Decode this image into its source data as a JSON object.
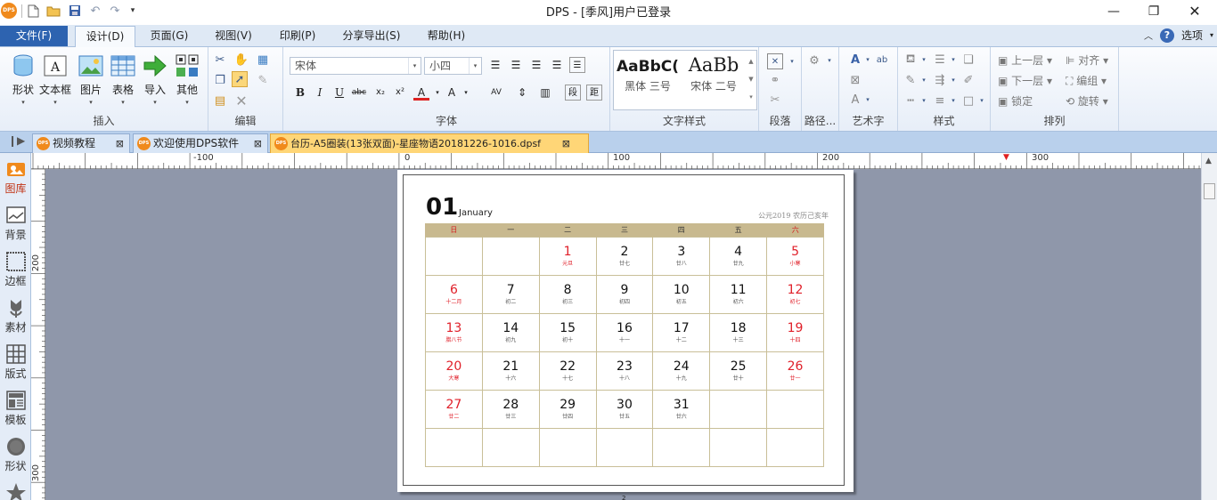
{
  "app": {
    "window_title": "DPS - [季风]用户已登录",
    "logo_text": "DPS"
  },
  "ribbon_tabs": {
    "file": "文件(F)",
    "tabs": [
      "设计(D)",
      "页面(G)",
      "视图(V)",
      "印刷(P)",
      "分享导出(S)",
      "帮助(H)"
    ],
    "active": "设计(D)",
    "options_label": "选项"
  },
  "ribbon": {
    "insert": {
      "buttons": [
        "形状",
        "文本框",
        "图片",
        "表格",
        "导入",
        "其他"
      ],
      "label": "插入"
    },
    "edit": {
      "label": "编辑"
    },
    "font": {
      "family": "宋体",
      "size": "小四",
      "label": "字体"
    },
    "text_style": {
      "samples": [
        {
          "sample": "AaBbC(",
          "caption": "黑体 三号"
        },
        {
          "sample": "AaBb",
          "caption": "宋体 二号"
        }
      ],
      "label": "文字样式"
    },
    "paragraph_label": "段落",
    "path_label": "路径...",
    "art_text_label": "艺术字",
    "style_label": "样式",
    "arrange": {
      "items": [
        "上一层",
        "对齐",
        "下一层",
        "编组",
        "锁定",
        "旋转"
      ],
      "label": "排列"
    }
  },
  "doc_tabs": [
    {
      "label": "视频教程",
      "active": false
    },
    {
      "label": "欢迎使用DPS软件",
      "active": false
    },
    {
      "label": "台历-A5圈装(13张双面)-星座物语20181226-1016.dpsf",
      "active": true
    }
  ],
  "left_panel": [
    {
      "label": "图库",
      "active": true
    },
    {
      "label": "背景",
      "active": false
    },
    {
      "label": "边框",
      "active": false
    },
    {
      "label": "素材",
      "active": false
    },
    {
      "label": "版式",
      "active": false
    },
    {
      "label": "模板",
      "active": false
    },
    {
      "label": "形状",
      "active": false
    }
  ],
  "rulers": {
    "h_labels": [
      "-100",
      "0",
      "100",
      "200",
      "300"
    ],
    "v_labels": [
      "200",
      "300"
    ]
  },
  "calendar": {
    "month_number": "01",
    "month_name": "January",
    "year_info": "公元2019 农历己亥年",
    "weekdays": [
      "日",
      "一",
      "二",
      "三",
      "四",
      "五",
      "六"
    ],
    "weeks": [
      [
        null,
        null,
        {
          "d": "1",
          "l": "元旦",
          "red": true
        },
        {
          "d": "2",
          "l": "廿七"
        },
        {
          "d": "3",
          "l": "廿八"
        },
        {
          "d": "4",
          "l": "廿九"
        },
        {
          "d": "5",
          "l": "小寒",
          "red": true
        }
      ],
      [
        {
          "d": "6",
          "l": "十二月",
          "red": true
        },
        {
          "d": "7",
          "l": "初二"
        },
        {
          "d": "8",
          "l": "初三"
        },
        {
          "d": "9",
          "l": "初四"
        },
        {
          "d": "10",
          "l": "初五"
        },
        {
          "d": "11",
          "l": "初六"
        },
        {
          "d": "12",
          "l": "初七",
          "red": true
        }
      ],
      [
        {
          "d": "13",
          "l": "腊八节",
          "red": true
        },
        {
          "d": "14",
          "l": "初九"
        },
        {
          "d": "15",
          "l": "初十"
        },
        {
          "d": "16",
          "l": "十一"
        },
        {
          "d": "17",
          "l": "十二"
        },
        {
          "d": "18",
          "l": "十三"
        },
        {
          "d": "19",
          "l": "十四",
          "red": true
        }
      ],
      [
        {
          "d": "20",
          "l": "大寒",
          "red": true
        },
        {
          "d": "21",
          "l": "十六"
        },
        {
          "d": "22",
          "l": "十七"
        },
        {
          "d": "23",
          "l": "十八"
        },
        {
          "d": "24",
          "l": "十九"
        },
        {
          "d": "25",
          "l": "廿十"
        },
        {
          "d": "26",
          "l": "廿一",
          "red": true
        }
      ],
      [
        {
          "d": "27",
          "l": "廿二",
          "red": true
        },
        {
          "d": "28",
          "l": "廿三"
        },
        {
          "d": "29",
          "l": "廿四"
        },
        {
          "d": "30",
          "l": "廿五"
        },
        {
          "d": "31",
          "l": "廿六"
        },
        null,
        null
      ],
      [
        null,
        null,
        null,
        null,
        null,
        null,
        null
      ]
    ],
    "page_number": "2"
  },
  "colors": {
    "file_tab": "#2d63b0",
    "calendar_header": "#c8b98f",
    "holiday_red": "#e0202a",
    "canvas_bg": "#8f97aa"
  }
}
